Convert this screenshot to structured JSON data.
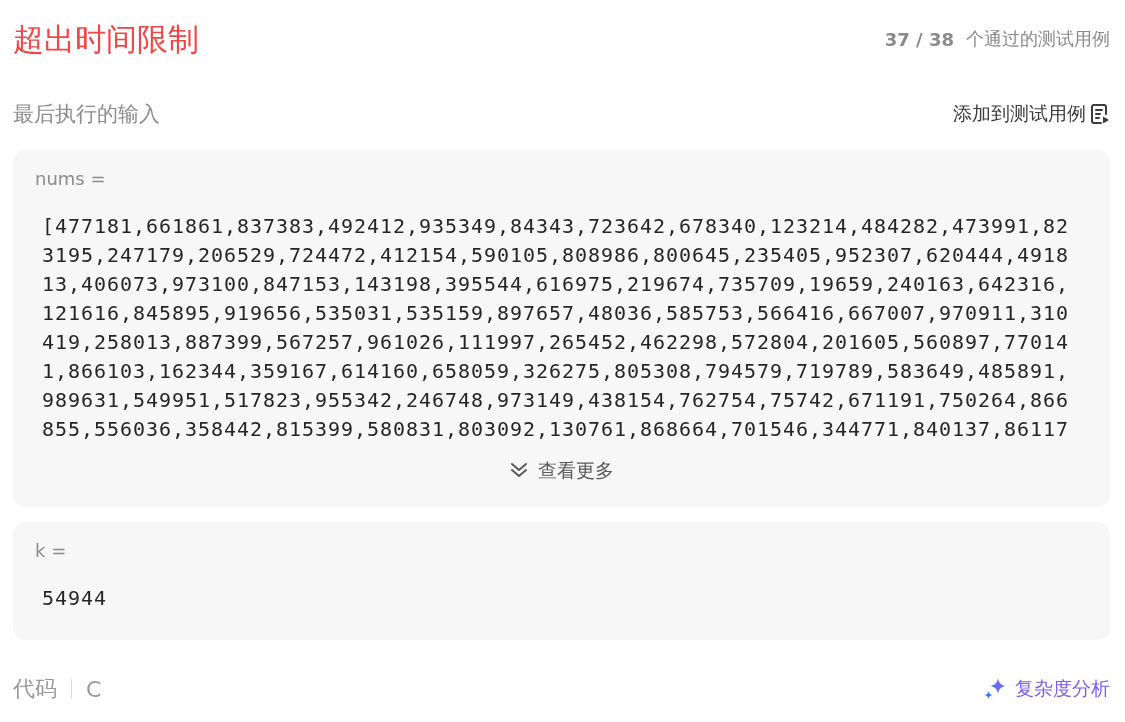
{
  "header": {
    "status": "超出时间限制",
    "passed": "37 / 38",
    "passed_label": "个通过的测试用例"
  },
  "last_input": {
    "title": "最后执行的输入",
    "add_button": "添加到测试用例"
  },
  "inputs": [
    {
      "name": "nums =",
      "value": "[477181,661861,837383,492412,935349,84343,723642,678340,123214,484282,473991,823195,247179,206529,724472,412154,590105,808986,800645,235405,952307,620444,491813,406073,973100,847153,143198,395544,616975,219674,735709,19659,240163,642316,121616,845895,919656,535031,535159,897657,48036,585753,566416,667007,970911,310419,258013,887399,567257,961026,111997,265452,462298,572804,201605,560897,770141,866103,162344,359167,614160,658059,326275,805308,794579,719789,583649,485891,989631,549951,517823,955342,246748,973149,438154,762754,75742,671191,750264,866855,556036,358442,815399,580831,803092,130761,868664,701546,344771,840137,86117",
      "expand_button": "查看更多"
    },
    {
      "name": "k =",
      "value": "54944"
    }
  ],
  "code": {
    "title": "代码",
    "language": "C",
    "analysis_button": "复杂度分析"
  }
}
